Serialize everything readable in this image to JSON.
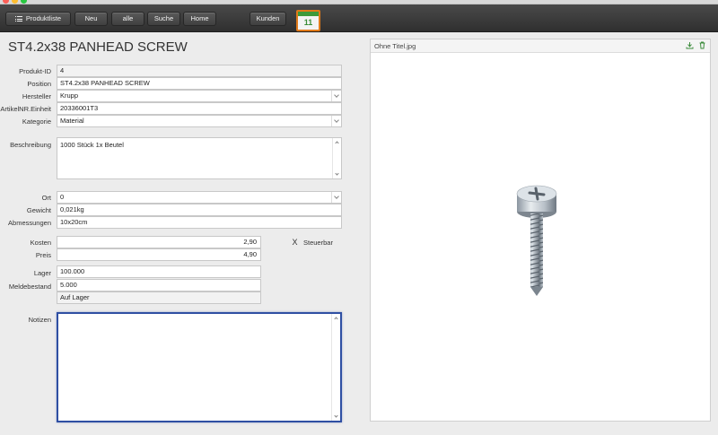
{
  "toolbar": {
    "produktliste": "Produktliste",
    "neu": "Neu",
    "alle": "alle",
    "suche": "Suche",
    "home": "Home",
    "kunden": "Kunden",
    "calendar_day": "11"
  },
  "product": {
    "title": "ST4.2x38 PANHEAD SCREW",
    "fields": {
      "produkt_id": {
        "label": "Produkt-ID",
        "value": "4"
      },
      "position": {
        "label": "Position",
        "value": "ST4.2x38 PANHEAD SCREW"
      },
      "hersteller": {
        "label": "Hersteller",
        "value": "Krupp"
      },
      "artikelnr": {
        "label": "ArtikelNR.Einheit",
        "value": "20336001T3"
      },
      "kategorie": {
        "label": "Kategorie",
        "value": "Material"
      },
      "beschreibung": {
        "label": "Beschreibung",
        "value": "1000 Stück 1x Beutel"
      },
      "ort": {
        "label": "Ort",
        "value": "0"
      },
      "gewicht": {
        "label": "Gewicht",
        "value": "0,021kg"
      },
      "abmessungen": {
        "label": "Abmessungen",
        "value": "10x20cm"
      },
      "kosten": {
        "label": "Kosten",
        "value": "2,90"
      },
      "preis": {
        "label": "Preis",
        "value": "4,90"
      },
      "steuerbar": {
        "label": "Steuerbar",
        "mark": "X"
      },
      "lager": {
        "label": "Lager",
        "value": "100.000"
      },
      "meldebestand": {
        "label": "Meldebestand",
        "value": "5.000"
      },
      "status": {
        "value": "Auf Lager"
      },
      "notizen": {
        "label": "Notizen",
        "value": ""
      }
    }
  },
  "image": {
    "filename": "Ohne Titel.jpg",
    "icons": [
      "export-icon",
      "trash-icon"
    ]
  },
  "colors": {
    "toolbar_bg": "#3a3a3a",
    "focus_border": "#2f4fa3",
    "calendar_border": "#e07a1a",
    "calendar_green": "#3d9a3a"
  }
}
